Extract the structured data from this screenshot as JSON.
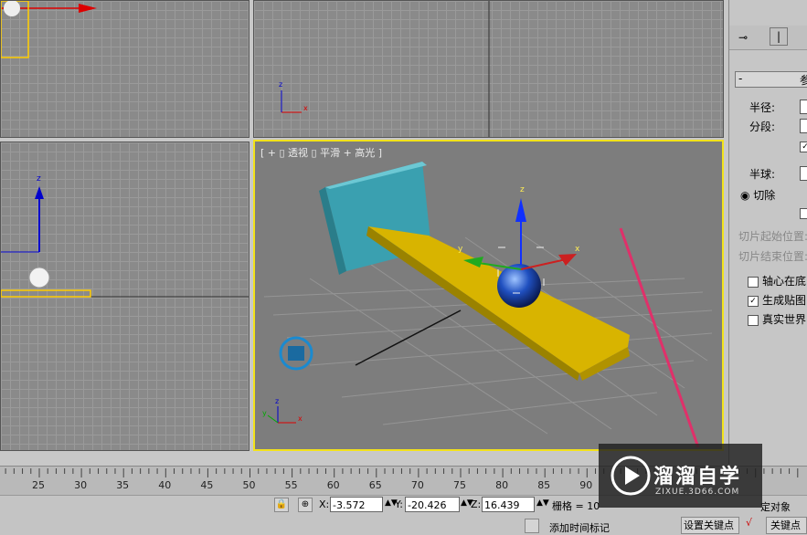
{
  "viewports": {
    "perspective_label": "[ + ▯ 透视 ▯ 平滑 + 高光 ]"
  },
  "panel": {
    "section_title": "参",
    "radius_label": "半径:",
    "segments_label": "分段:",
    "hemisphere_label": "半球:",
    "cut_label": "切除",
    "slice_from_label": "切片起始位置:",
    "slice_to_label": "切片结束位置:",
    "base_to_pivot_label": "轴心在底",
    "gen_mapping_label": "生成贴图",
    "real_world_label": "真实世界"
  },
  "timeline": {
    "ticks": [
      "25",
      "30",
      "35",
      "40",
      "45",
      "50",
      "55",
      "60",
      "65",
      "70",
      "75",
      "80",
      "85",
      "90"
    ]
  },
  "status": {
    "x_label": "X:",
    "x_value": "-3.572",
    "y_label": "Y:",
    "y_value": "-20.426",
    "z_label": "Z:",
    "z_value": "16.439",
    "grid_label": "栅格 = 10",
    "add_time_tag": "添加时间标记",
    "set_key": "设置关键点",
    "key_filter": "关键点",
    "selected_object": "定对象"
  },
  "watermark": {
    "brand": "溜溜自学",
    "url": "ZIXUE.3D66.COM"
  },
  "colors": {
    "viewport_active_border": "#f2e21a",
    "plank": "#d8b400",
    "box": "#3aa0b0",
    "sphere": "#2050c0",
    "arrow_pointer": "#e0306a"
  }
}
